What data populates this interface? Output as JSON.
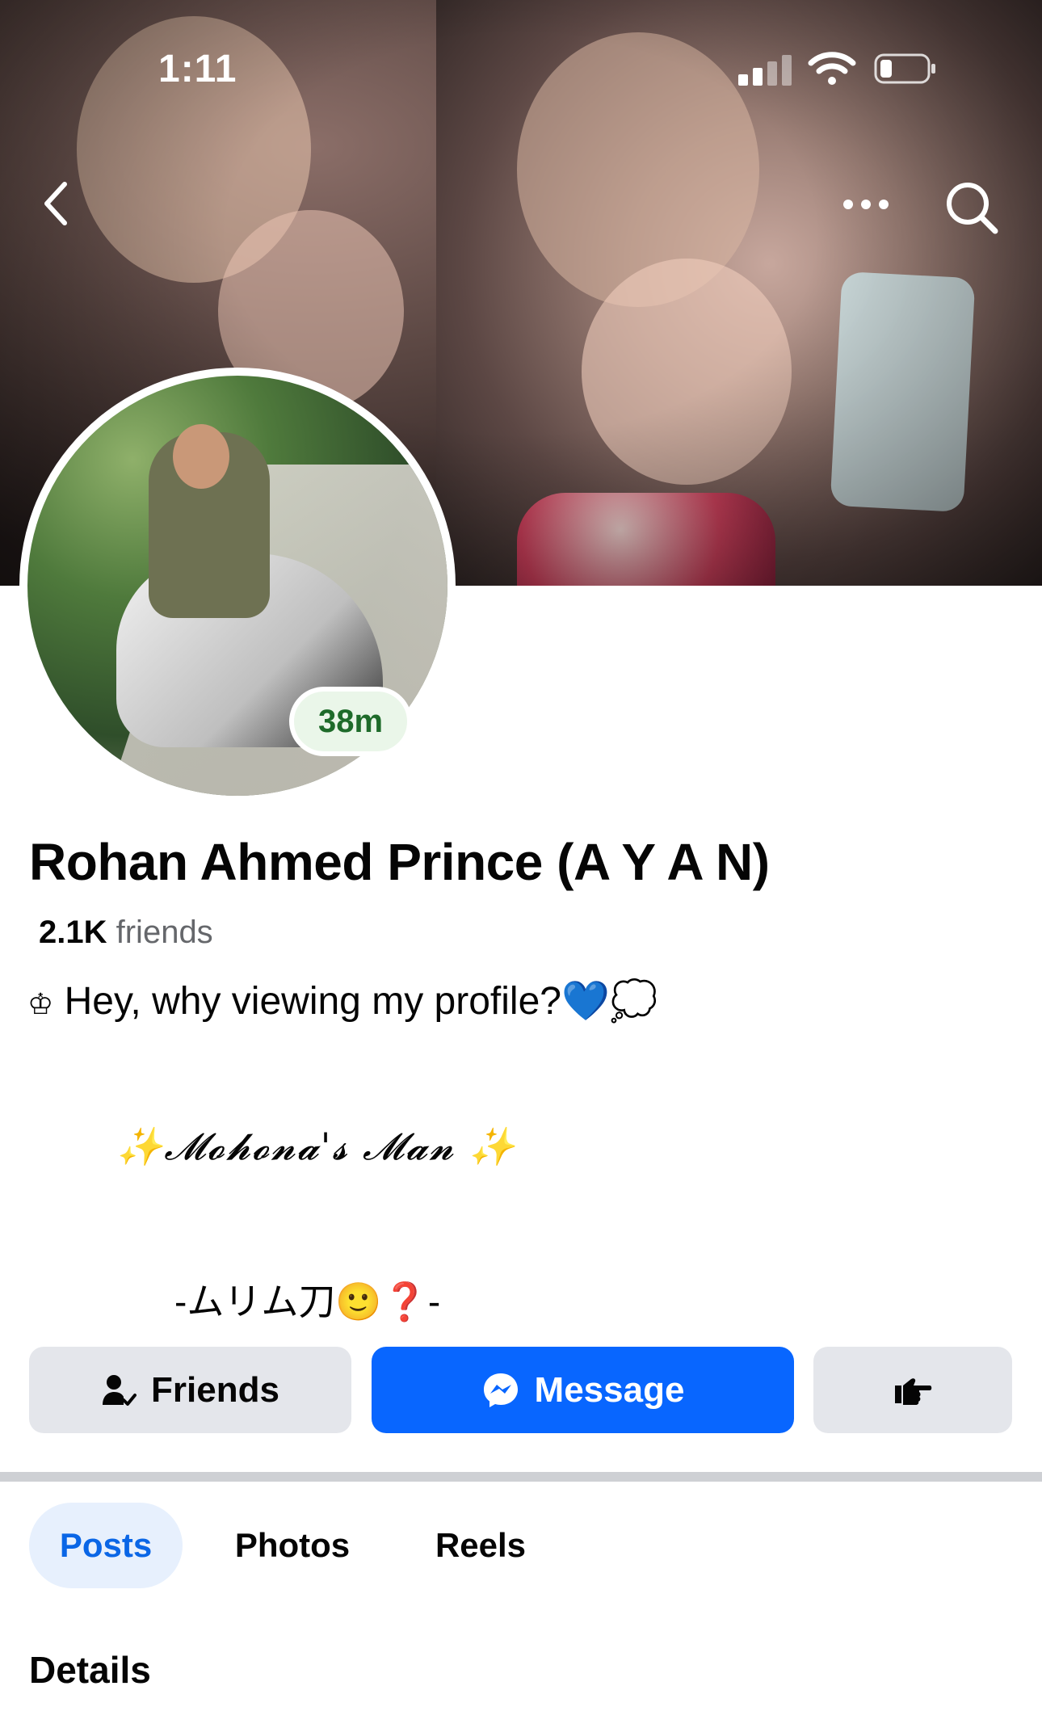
{
  "status_bar": {
    "time": "1:11"
  },
  "nav": {
    "back_icon": "chevron-left-icon",
    "more_icon": "ellipsis-icon",
    "search_icon": "search-icon"
  },
  "profile": {
    "active_badge": "38m",
    "name": "Rohan Ahmed Prince (A Y A N)",
    "friends_count": "2.1K",
    "friends_label": "friends",
    "bio_line1": "Hey, why viewing my profile?💙💭",
    "bio_line1_prefix": "♔",
    "bio_line2": "✨𝓜𝓸𝓱𝓸𝓷𝓪'𝓼 𝓜𝓪𝓷 ✨",
    "bio_line3": "-ムリム刀🙂❓-"
  },
  "actions": {
    "friends_label": "Friends",
    "message_label": "Message",
    "more_icon": "hand-pointing-icon"
  },
  "tabs": [
    {
      "label": "Posts",
      "active": true
    },
    {
      "label": "Photos",
      "active": false
    },
    {
      "label": "Reels",
      "active": false
    }
  ],
  "section": {
    "details_title": "Details"
  },
  "colors": {
    "primary_blue": "#0866ff",
    "tab_active_bg": "#e7f0fd",
    "tab_active_text": "#0a66e6",
    "button_gray": "#e4e6eb",
    "active_badge_text": "#1e6b2a"
  }
}
